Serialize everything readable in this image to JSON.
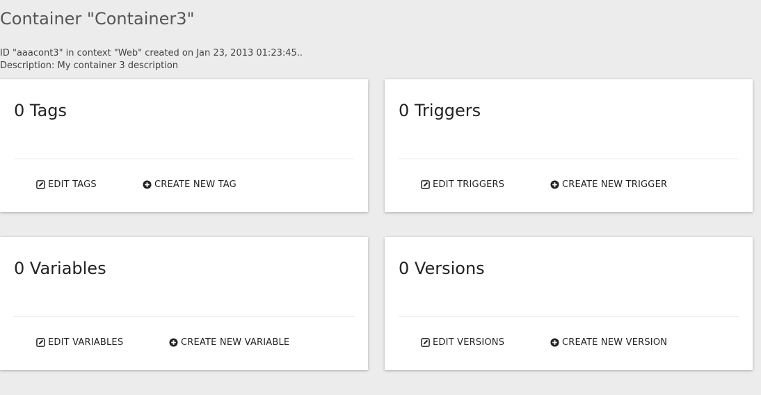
{
  "header": {
    "title": "Container \"Container3\"",
    "id_line": "ID \"aaacont3\" in context \"Web\" created on Jan 23, 2013 01:23:45..",
    "description_line": "Description: My container 3 description"
  },
  "cards": {
    "tags": {
      "title": "0 Tags",
      "edit_label": "EDIT TAGS",
      "create_label": "CREATE NEW TAG"
    },
    "triggers": {
      "title": "0 Triggers",
      "edit_label": "EDIT TRIGGERS",
      "create_label": "CREATE NEW TRIGGER"
    },
    "variables": {
      "title": "0 Variables",
      "edit_label": "EDIT VARIABLES",
      "create_label": "CREATE NEW VARIABLE"
    },
    "versions": {
      "title": "0 Versions",
      "edit_label": "EDIT VERSIONS",
      "create_label": "CREATE NEW VERSION"
    }
  },
  "icons": {
    "edit": "edit-icon",
    "create": "plus-circle-icon"
  },
  "colors": {
    "background": "#ececec",
    "card": "#ffffff",
    "title_text": "#555555",
    "text": "#222222"
  }
}
